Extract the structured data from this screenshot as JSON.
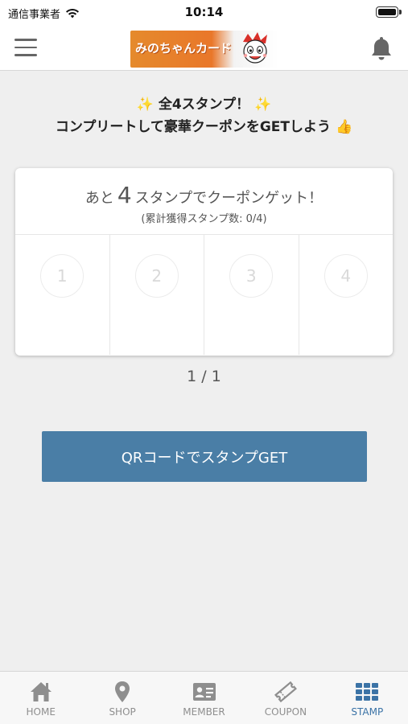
{
  "status_bar": {
    "carrier": "通信事業者",
    "time": "10:14"
  },
  "header": {
    "logo_text": "みのちゃんカード"
  },
  "headline": {
    "line1_prefix": "✨",
    "line1_text": "全4スタンプ！",
    "line1_suffix": "✨",
    "line2_text": "コンプリートして豪華クーポンをGETしよう",
    "line2_emoji": "👍"
  },
  "stamp_card": {
    "remaining_prefix": "あと",
    "remaining_count": "4",
    "remaining_suffix": "スタンプでクーポンゲット！",
    "cumulative": "(累計獲得スタンプ数: 0/4)",
    "slots": [
      "1",
      "2",
      "3",
      "4"
    ]
  },
  "pager": "1 / 1",
  "qr_button_label": "QRコードでスタンプGET",
  "tabbar": {
    "tabs": [
      {
        "label": "HOME",
        "icon": "home-icon",
        "active": false
      },
      {
        "label": "SHOP",
        "icon": "location-pin-icon",
        "active": false
      },
      {
        "label": "MEMBER",
        "icon": "member-card-icon",
        "active": false
      },
      {
        "label": "COUPON",
        "icon": "coupon-ticket-icon",
        "active": false
      },
      {
        "label": "STAMP",
        "icon": "stamp-grid-icon",
        "active": true
      }
    ],
    "active_color": "#3b73a6",
    "inactive_color": "#8e8e8e"
  },
  "colors": {
    "button": "#4a7ea6",
    "background": "#efefef"
  }
}
